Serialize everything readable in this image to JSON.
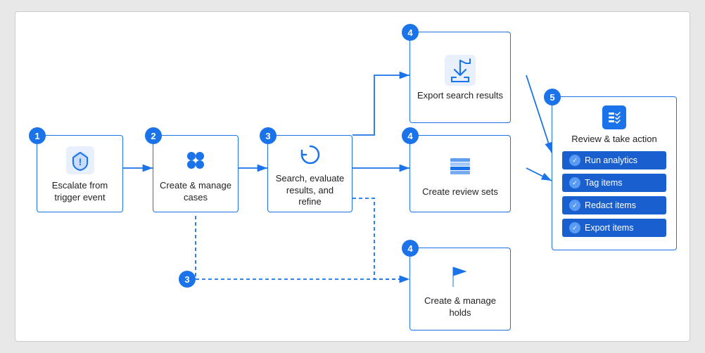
{
  "steps": [
    {
      "id": "step1",
      "badge": "1",
      "label": "Escalate from trigger event",
      "icon": "shield-exclamation"
    },
    {
      "id": "step2",
      "badge": "2",
      "label": "Create & manage cases",
      "icon": "grid-dots"
    },
    {
      "id": "step3",
      "badge": "3",
      "label": "Search, evaluate results, and refine",
      "icon": "refresh-circle"
    },
    {
      "id": "step4a",
      "badge": "4",
      "label": "Export search results",
      "icon": "export-arrow"
    },
    {
      "id": "step4b",
      "badge": "4",
      "label": "Create review sets",
      "icon": "layers"
    },
    {
      "id": "step4c",
      "badge": "4",
      "label": "Create & manage holds",
      "icon": "flag"
    }
  ],
  "review_panel": {
    "badge": "5",
    "title": "Review & take action",
    "actions": [
      "Run analytics",
      "Tag items",
      "Redact items",
      "Export items"
    ]
  }
}
